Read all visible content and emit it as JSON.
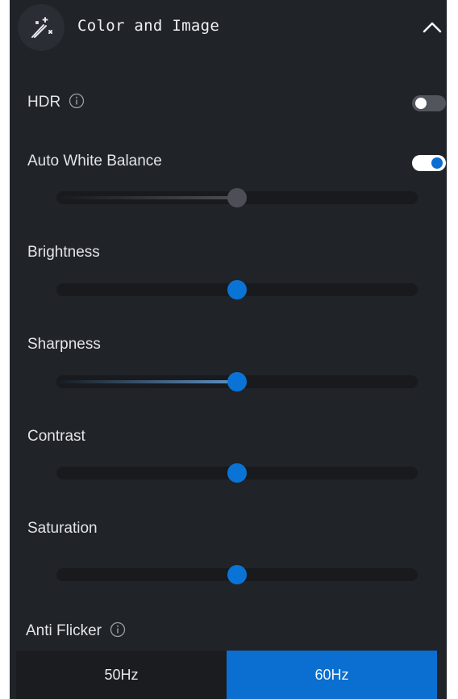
{
  "header": {
    "title": "Color and Image",
    "icon": "magic-wand-icon",
    "collapse_icon": "chevron-up-icon"
  },
  "hdr": {
    "label": "HDR",
    "info_icon": "info-icon",
    "enabled": false
  },
  "auto_white_balance": {
    "label": "Auto White Balance",
    "enabled": true,
    "slider_level": 0.5,
    "slider_disabled": true
  },
  "brightness": {
    "label": "Brightness",
    "level": 0.5
  },
  "sharpness": {
    "label": "Sharpness",
    "level": 0.5
  },
  "contrast": {
    "label": "Contrast",
    "level": 0.5
  },
  "saturation": {
    "label": "Saturation",
    "level": 0.5
  },
  "anti_flicker": {
    "label": "Anti Flicker",
    "info_icon": "info-icon",
    "options": [
      "50Hz",
      "60Hz"
    ],
    "selected": "60Hz"
  },
  "colors": {
    "panel_bg": "#202328",
    "accent": "#0a6fd0",
    "track": "#181a1e",
    "text": "#e2e4e6"
  }
}
